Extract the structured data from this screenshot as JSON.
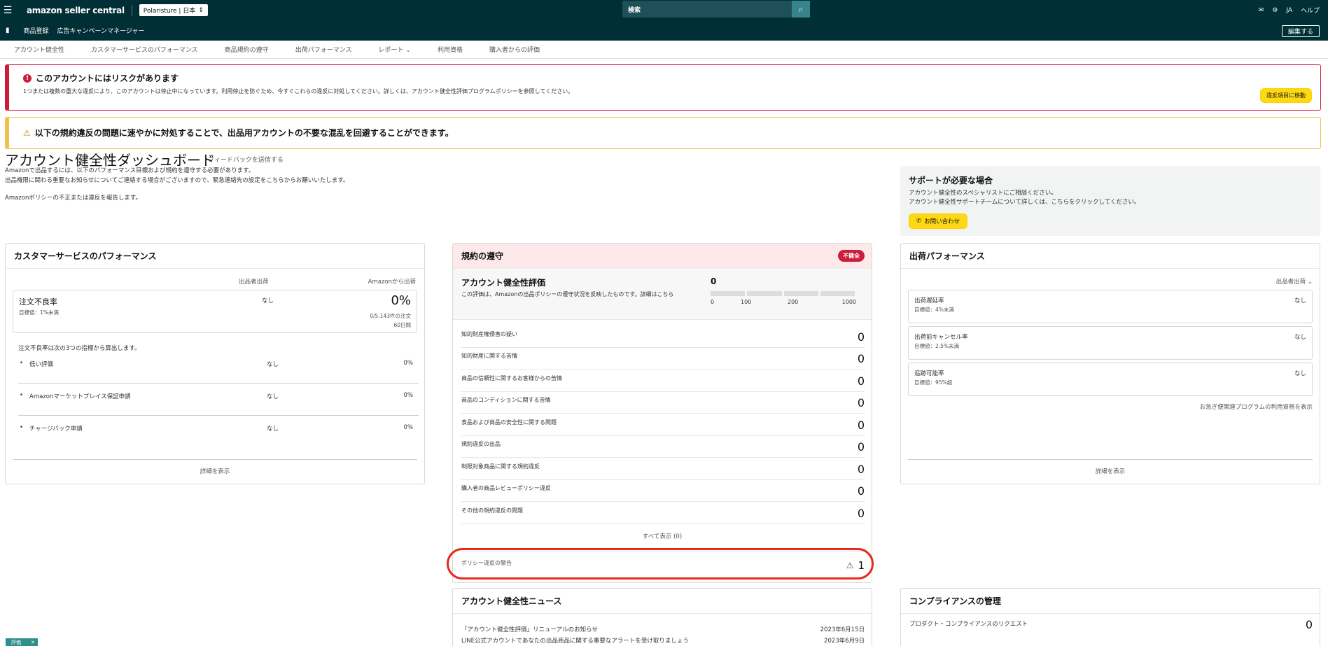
{
  "topnav": {
    "logo": "amazon seller central",
    "store": "Polaristure | 日本",
    "search_placeholder": "検索",
    "lang": "JA",
    "help": "ヘルプ"
  },
  "subnav": {
    "items": [
      "商品登録",
      "広告キャンペーンマネージャー"
    ],
    "edit": "編集する"
  },
  "tabs": [
    "アカウント健全性",
    "カスタマーサービスのパフォーマンス",
    "商品規約の遵守",
    "出荷パフォーマンス",
    "レポート",
    "利用資格",
    "購入者からの評価"
  ],
  "alert_risk": {
    "title": "このアカウントにはリスクがあります",
    "desc": "1つまたは複数の重大な違反により、このアカウントは停止中になっています。利用停止を防ぐため、今すぐこれらの違反に対処してください。詳しくは、アカウント健全性評価プログラムポリシーを参照してください。",
    "button": "違反項目に移動"
  },
  "alert_warn": {
    "title": "以下の規約違反の問題に速やかに対処することで、出品用アカウントの不要な混乱を回避することができます。"
  },
  "dashboard": {
    "title": "アカウント健全性ダッシュボード",
    "feedback": "フィードバックを送信する",
    "intro1": "Amazonで出品するには、以下のパフォーマンス目標および規約を遵守する必要があります。",
    "intro2": "出品権限に関わる重要なお知らせについてご連絡する場合がございますので、緊急連絡先の設定をこちらからお願いいたします。",
    "report": "Amazonポリシーの不正または違反を報告します。"
  },
  "support": {
    "title": "サポートが必要な場合",
    "line1": "アカウント健全性のスペシャリストにご相談ください。",
    "line2": "アカウント健全性サポートチームについて詳しくは、こちらをクリックしてください。",
    "button": "お問い合わせ"
  },
  "customer_service": {
    "title": "カスタマーサービスのパフォーマンス",
    "col_seller": "出品者出荷",
    "col_amazon": "Amazonから出荷",
    "odr_name": "注文不良率",
    "odr_target": "目標値：1%未満",
    "odr_seller": "なし",
    "odr_pct": "0%",
    "odr_sub1": "0/5,143件の注文",
    "odr_sub2": "60日間",
    "note": "注文不良率は次の3つの指標から算出します。",
    "metrics": [
      {
        "name": "低い評価",
        "seller": "なし",
        "value": "0%"
      },
      {
        "name": "Amazonマーケットプレイス保証申請",
        "seller": "なし",
        "value": "0%"
      },
      {
        "name": "チャージバック申請",
        "seller": "なし",
        "value": "0%"
      }
    ],
    "footer": "詳細を表示"
  },
  "policy": {
    "title": "規約の遵守",
    "badge": "不健全",
    "rating_title": "アカウント健全性評価",
    "rating_desc": "この評価は、Amazonの出品ポリシーの遵守状況を反映したものです。詳細はこちら",
    "rating_value": "0",
    "ticks": [
      "0",
      "100",
      "200",
      "1000"
    ],
    "rows": [
      {
        "name": "知的財産権侵害の疑い",
        "value": "0"
      },
      {
        "name": "知的財産に関する苦情",
        "value": "0"
      },
      {
        "name": "商品の信頼性に関するお客様からの苦情",
        "value": "0"
      },
      {
        "name": "商品のコンディションに関する苦情",
        "value": "0"
      },
      {
        "name": "食品および商品の安全性に関する問題",
        "value": "0"
      },
      {
        "name": "規約違反の出品",
        "value": "0"
      },
      {
        "name": "制限対象商品に関する規約違反",
        "value": "0"
      },
      {
        "name": "購入者の商品レビューポリシー違反",
        "value": "0"
      },
      {
        "name": "その他の規約違反の問題",
        "value": "0"
      }
    ],
    "show_all": "すべて表示 (0)",
    "warning_name": "ポリシー違反の警告",
    "warning_value": "1"
  },
  "shipping": {
    "title": "出荷パフォーマンス",
    "filter": "出品者出荷",
    "metrics": [
      {
        "name": "出荷遅延率",
        "target": "目標値：4%未満",
        "value": "なし"
      },
      {
        "name": "出荷前キャンセル率",
        "target": "目標値：2.5%未満",
        "value": "なし"
      },
      {
        "name": "追跡可能率",
        "target": "目標値：95%超",
        "value": "なし"
      }
    ],
    "program": "お急ぎ便関連プログラムの利用資格を表示",
    "footer": "詳細を表示"
  },
  "news": {
    "title": "アカウント健全性ニュース",
    "items": [
      {
        "text": "「アカウント健全性評価」リニューアルのお知らせ",
        "date": "2023年6月15日"
      },
      {
        "text": "LINE公式アカウントであなたの出品商品に関する重要なアラートを受け取りましょう",
        "date": "2023年6月9日"
      }
    ]
  },
  "compliance": {
    "title": "コンプライアンスの管理",
    "request": "プロダクト・コンプライアンスのリクエスト",
    "value": "0"
  },
  "bottom_tag": "評価"
}
